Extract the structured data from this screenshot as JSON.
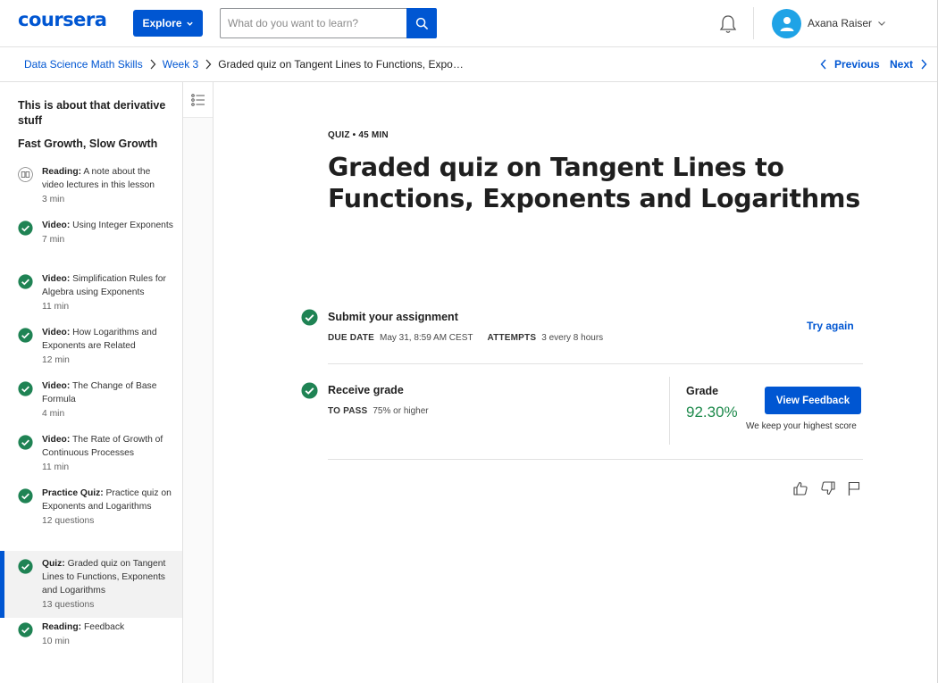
{
  "header": {
    "logo": "coursera",
    "explore_label": "Explore",
    "search_placeholder": "What do you want to learn?",
    "user_name": "Axana Raiser"
  },
  "breadcrumb": {
    "items": [
      "Data Science Math Skills",
      "Week 3"
    ],
    "current": "Graded quiz on Tangent Lines to Functions, Expo…"
  },
  "nav": {
    "previous": "Previous",
    "next": "Next"
  },
  "sidebar": {
    "module_title": "This is about that derivative stuff",
    "section_title": "Fast Growth, Slow Growth",
    "items": [
      {
        "type": "Reading:",
        "title": "A note about the video lectures in this lesson",
        "duration": "3 min",
        "status": "reading-icon",
        "active": false
      },
      {
        "type": "Video:",
        "title": "Using Integer Exponents",
        "duration": "7 min",
        "status": "completed",
        "active": false
      },
      {
        "type": "Video:",
        "title": "Simplification Rules for Algebra using Exponents",
        "duration": "11 min",
        "status": "completed",
        "active": false
      },
      {
        "type": "Video:",
        "title": "How Logarithms and Exponents are Related",
        "duration": "12 min",
        "status": "completed",
        "active": false
      },
      {
        "type": "Video:",
        "title": "The Change of Base Formula",
        "duration": "4 min",
        "status": "completed",
        "active": false
      },
      {
        "type": "Video:",
        "title": "The Rate of Growth of Continuous Processes",
        "duration": "11 min",
        "status": "completed",
        "active": false
      },
      {
        "type": "Practice Quiz:",
        "title": "Practice quiz on Exponents and Logarithms",
        "duration": "12 questions",
        "status": "completed",
        "active": false
      },
      {
        "type": "Quiz:",
        "title": "Graded quiz on Tangent Lines to Functions, Exponents and Logarithms",
        "duration": "13 questions",
        "status": "completed",
        "active": true
      },
      {
        "type": "Reading:",
        "title": "Feedback",
        "duration": "10 min",
        "status": "completed",
        "active": false
      }
    ]
  },
  "main": {
    "meta": "QUIZ • 45 MIN",
    "title": "Graded quiz on Tangent Lines to Functions, Exponents and Logarithms",
    "submit": {
      "title": "Submit your assignment",
      "due_label": "DUE DATE",
      "due_value": "May 31, 8:59 AM CEST",
      "attempts_label": "ATTEMPTS",
      "attempts_value": "3 every 8 hours",
      "try_again": "Try again"
    },
    "receive": {
      "title": "Receive grade",
      "pass_label": "TO PASS",
      "pass_value": "75% or higher",
      "grade_label": "Grade",
      "grade_value": "92.30%",
      "view_feedback": "View Feedback",
      "keep_note": "We keep your highest score"
    }
  },
  "colors": {
    "brand": "#0056d2",
    "success": "#1e8a4c",
    "check": "#1f8354",
    "active_bg": "#f2f2f2",
    "avatar": "#1fa3e6"
  }
}
